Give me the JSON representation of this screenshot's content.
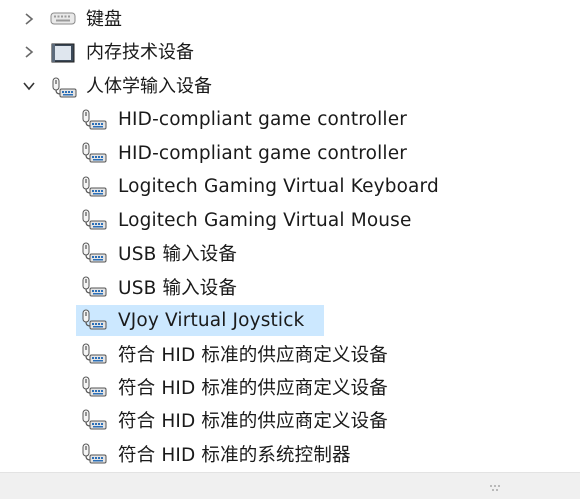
{
  "categories": [
    {
      "label": "键盘",
      "expanded": false,
      "icon": "keyboard-icon"
    },
    {
      "label": "内存技术设备",
      "expanded": false,
      "icon": "memory-device-icon"
    },
    {
      "label": "人体学输入设备",
      "expanded": true,
      "icon": "hid-device-icon"
    }
  ],
  "devices": [
    {
      "label": "HID-compliant game controller",
      "icon": "hid-device-icon",
      "selected": false
    },
    {
      "label": "HID-compliant game controller",
      "icon": "hid-device-icon",
      "selected": false
    },
    {
      "label": "Logitech Gaming Virtual Keyboard",
      "icon": "hid-device-icon",
      "selected": false
    },
    {
      "label": "Logitech Gaming Virtual Mouse",
      "icon": "hid-device-icon",
      "selected": false
    },
    {
      "label": "USB 输入设备",
      "icon": "hid-device-icon",
      "selected": false
    },
    {
      "label": "USB 输入设备",
      "icon": "hid-device-icon",
      "selected": false
    },
    {
      "label": "VJoy Virtual Joystick",
      "icon": "hid-device-icon",
      "selected": true
    },
    {
      "label": "符合 HID 标准的供应商定义设备",
      "icon": "hid-device-icon",
      "selected": false
    },
    {
      "label": "符合 HID 标准的供应商定义设备",
      "icon": "hid-device-icon",
      "selected": false
    },
    {
      "label": "符合 HID 标准的供应商定义设备",
      "icon": "hid-device-icon",
      "selected": false
    },
    {
      "label": "符合 HID 标准的系统控制器",
      "icon": "hid-device-icon",
      "selected": false
    }
  ],
  "colors": {
    "selection": "#cce8ff",
    "text": "#1a1a1a",
    "icon_blue": "#2c6fb7"
  }
}
